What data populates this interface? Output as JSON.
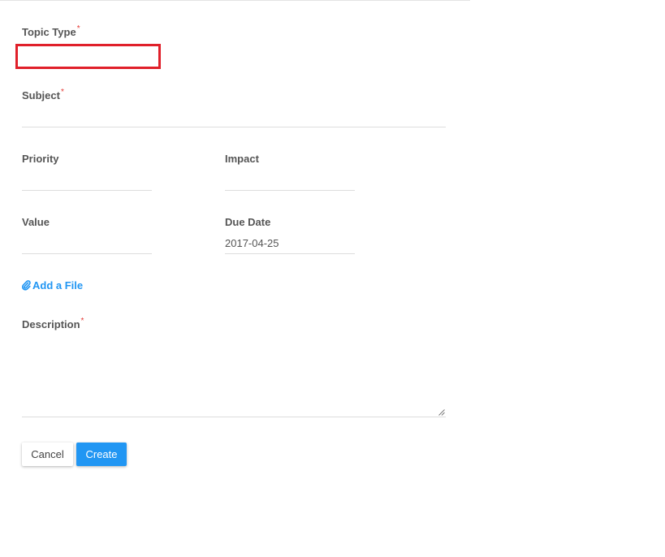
{
  "form": {
    "topic_type": {
      "label": "Topic Type",
      "required_mark": "*",
      "value": ""
    },
    "subject": {
      "label": "Subject",
      "required_mark": "*",
      "value": ""
    },
    "priority": {
      "label": "Priority",
      "value": ""
    },
    "impact": {
      "label": "Impact",
      "value": ""
    },
    "value_field": {
      "label": "Value",
      "value": ""
    },
    "due_date": {
      "label": "Due Date",
      "value": "2017-04-25"
    },
    "attachment": {
      "label": "Add a File",
      "icon": "paperclip-icon"
    },
    "description": {
      "label": "Description",
      "required_mark": "*",
      "value": ""
    }
  },
  "buttons": {
    "cancel_label": "Cancel",
    "create_label": "Create"
  },
  "colors": {
    "accent": "#2196f3",
    "required": "#e53935",
    "highlight_border": "#e0202a",
    "label": "#555555"
  }
}
